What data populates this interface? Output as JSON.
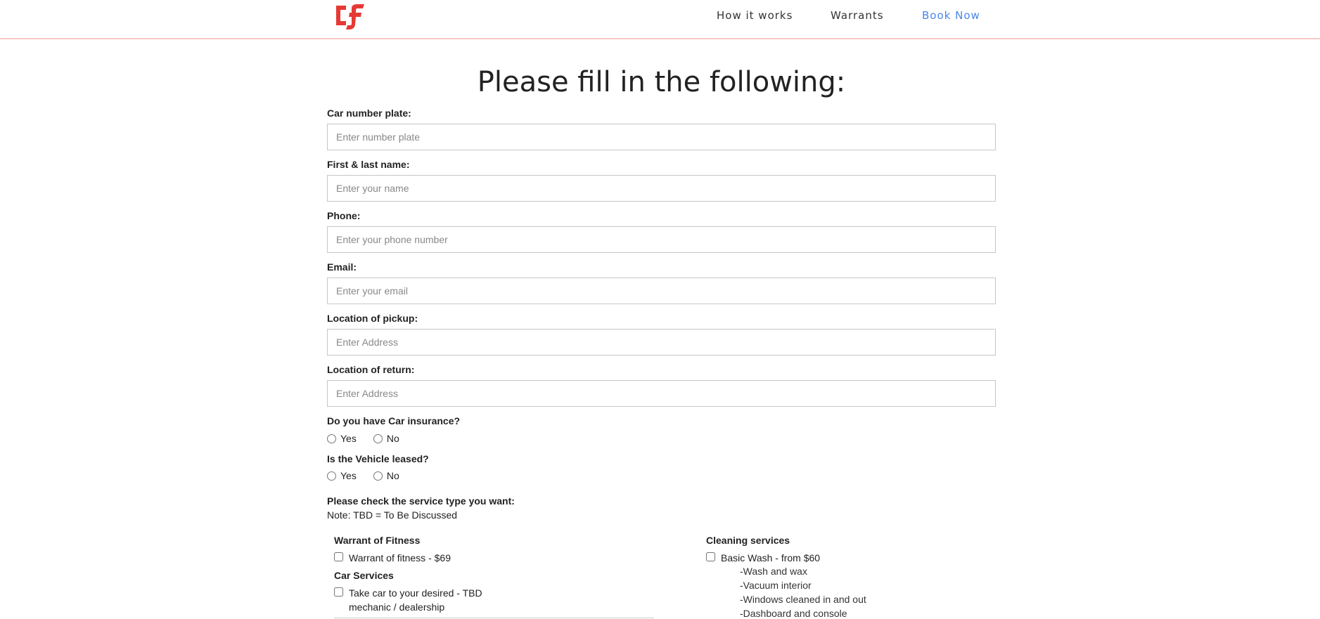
{
  "nav": {
    "logo_text": "cf",
    "links": [
      {
        "label": "How it works"
      },
      {
        "label": "Warrants"
      },
      {
        "label": "Book Now"
      }
    ],
    "active_color": "#4a86e8",
    "brand_color": "#e53935"
  },
  "form": {
    "title": "Please fill in the following:",
    "fields": [
      {
        "label": "Car number plate:",
        "placeholder": "Enter number plate",
        "value": ""
      },
      {
        "label": "First & last name:",
        "placeholder": "Enter your name",
        "value": ""
      },
      {
        "label": "Phone:",
        "placeholder": "Enter your phone number",
        "value": ""
      },
      {
        "label": "Email:",
        "placeholder": "Enter your email",
        "value": ""
      },
      {
        "label": "Location of pickup:",
        "placeholder": "Enter Address",
        "value": ""
      },
      {
        "label": "Location of return:",
        "placeholder": "Enter Address",
        "value": ""
      }
    ],
    "insurance": {
      "question": "Do you have Car insurance?",
      "options": [
        "Yes",
        "No"
      ]
    },
    "leased": {
      "question": "Is the Vehicle leased?",
      "options": [
        "Yes",
        "No"
      ]
    },
    "service_prompt": "Please check the service type you want:",
    "service_note": "Note: TBD = To Be Discussed"
  },
  "services": {
    "wof": {
      "heading": "Warrant of Fitness",
      "item": "Warrant of fitness - $69"
    },
    "car": {
      "heading": "Car Services",
      "item_line1": "Take car to your desired - TBD",
      "item_line2": "mechanic / dealership"
    },
    "cleaning": {
      "heading": "Cleaning services",
      "item": "Basic Wash - from $60",
      "subitems": [
        "-Wash and wax",
        "-Vacuum interior",
        "-Windows cleaned in and out",
        "-Dashboard and console"
      ]
    }
  }
}
